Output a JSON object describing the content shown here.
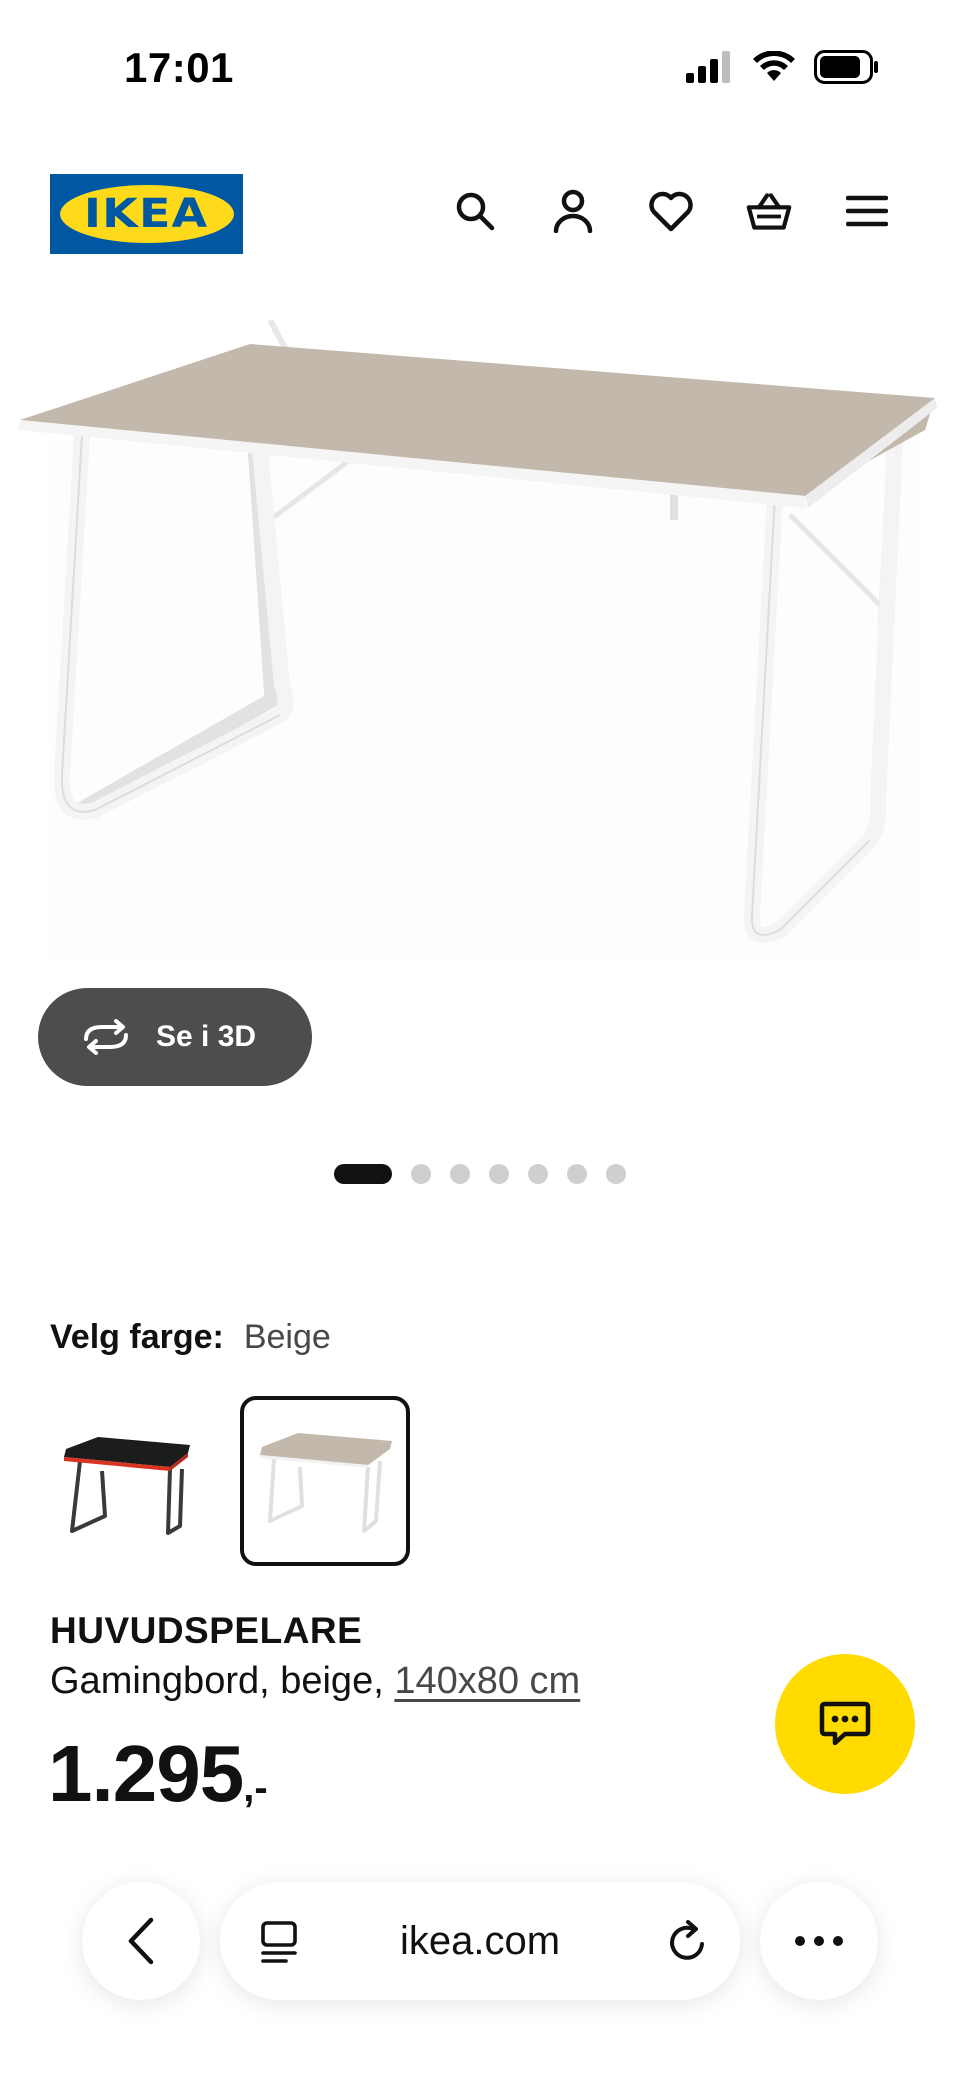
{
  "status_bar": {
    "time": "17:01"
  },
  "brand": {
    "logo_text": "IKEA",
    "blue": "#0058a3",
    "yellow": "#ffda1a"
  },
  "header": {
    "icons": [
      "search-icon",
      "account-icon",
      "heart-icon",
      "basket-icon",
      "menu-icon"
    ]
  },
  "product": {
    "view_3d_label": "Se i 3D",
    "carousel": {
      "total": 7,
      "active": 1
    },
    "color_label": "Velg farge:",
    "color_value": "Beige",
    "name": "HUVUDSPELARE",
    "description": "Gamingbord, beige,",
    "size": "140x80 cm",
    "price": "1.295",
    "price_suffix": ",-"
  },
  "browser": {
    "url": "ikea.com"
  },
  "colors": {
    "chat_button": "#ffdb00",
    "tabletop_beige": "#c2b8ab",
    "dark_pill": "#4d4d4d"
  }
}
